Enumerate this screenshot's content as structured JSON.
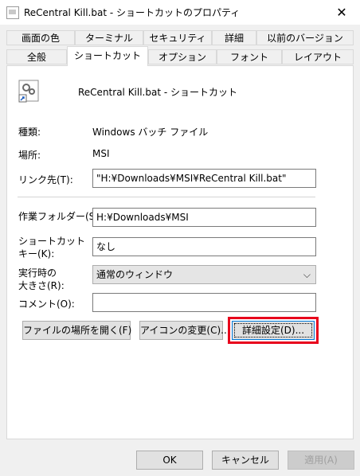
{
  "window": {
    "title": "ReCentral Kill.bat - ショートカットのプロパティ",
    "close_glyph": "✕"
  },
  "tabs": {
    "row1": [
      "画面の色",
      "ターミナル",
      "セキュリティ",
      "詳細",
      "以前のバージョン"
    ],
    "row2": [
      "全般",
      "ショートカット",
      "オプション",
      "フォント",
      "レイアウト"
    ],
    "active": "ショートカット"
  },
  "shortcut": {
    "name": "ReCentral Kill.bat - ショートカット",
    "type_label": "種類:",
    "type_value": "Windows バッチ ファイル",
    "location_label": "場所:",
    "location_value": "MSI",
    "target_label": "リンク先(T):",
    "target_value": "\"H:¥Downloads¥MSI¥ReCentral Kill.bat\"",
    "start_in_label": "作業フォルダー(S):",
    "start_in_value": "H:¥Downloads¥MSI",
    "hotkey_label_1": "ショートカット",
    "hotkey_label_2": "キー(K):",
    "hotkey_value": "なし",
    "run_label_1": "実行時の",
    "run_label_2": "大きさ(R):",
    "run_value": "通常のウィンドウ",
    "comment_label": "コメント(O):",
    "comment_value": ""
  },
  "buttons": {
    "open_location": "ファイルの場所を開く(F)",
    "change_icon": "アイコンの変更(C)...",
    "advanced": "詳細設定(D)...",
    "ok": "OK",
    "cancel": "キャンセル",
    "apply": "適用(A)"
  },
  "colors": {
    "highlight": "#e8001c"
  }
}
